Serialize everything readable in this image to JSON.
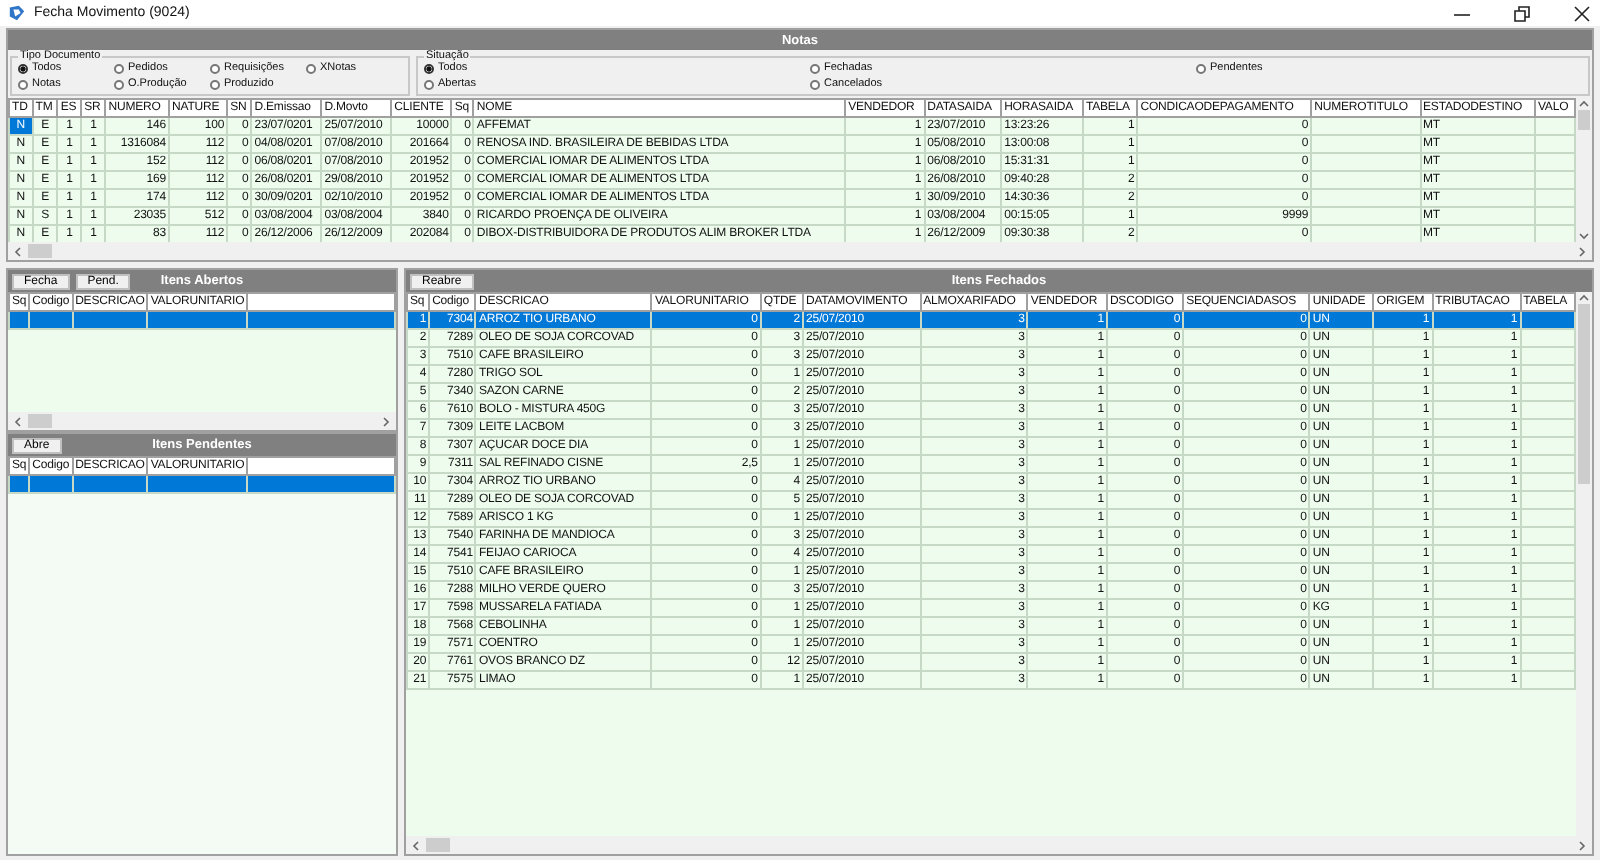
{
  "window": {
    "title": "Fecha Movimento (9024)"
  },
  "notas": {
    "title": "Notas",
    "tipo_documento": {
      "legend": "Tipo Documento",
      "options": [
        {
          "label": "Todos",
          "selected": true
        },
        {
          "label": "Pedidos",
          "selected": false
        },
        {
          "label": "Requisições",
          "selected": false
        },
        {
          "label": "XNotas",
          "selected": false
        },
        {
          "label": "Notas",
          "selected": false
        },
        {
          "label": "O.Produção",
          "selected": false
        },
        {
          "label": "Produzido",
          "selected": false
        }
      ]
    },
    "situacao": {
      "legend": "Situação",
      "options": [
        {
          "label": "Todos",
          "selected": true
        },
        {
          "label": "Fechadas",
          "selected": false
        },
        {
          "label": "Pendentes",
          "selected": false
        },
        {
          "label": "Abertas",
          "selected": false
        },
        {
          "label": "Cancelados",
          "selected": false
        }
      ]
    },
    "table": {
      "columns": [
        "TD",
        "TM",
        "ES",
        "SR",
        "NUMERO",
        "NATURE",
        "SN",
        "D.Emissao",
        "D.Movto",
        "CLIENTE",
        "Sq",
        "NOME",
        "VENDEDOR",
        "DATASAIDA",
        "HORASAIDA",
        "TABELA",
        "CONDICAODEPAGAMENTO",
        "NUMEROTITULO",
        "ESTADODESTINO",
        "VALO"
      ],
      "rows": [
        {
          "selected": true,
          "cells": [
            "N",
            "E",
            "1",
            "1",
            "146",
            "100",
            "0",
            "23/07/0201",
            "25/07/2010",
            "10000",
            "0",
            "AFFEMAT",
            "1",
            "23/07/2010",
            "13:23:26",
            "1",
            "0",
            null,
            "MT"
          ]
        },
        {
          "selected": false,
          "cells": [
            "N",
            "E",
            "1",
            "1",
            "1316084",
            "112",
            "0",
            "04/08/0201",
            "07/08/2010",
            "201664",
            "0",
            "RENOSA IND. BRASILEIRA DE BEBIDAS LTDA",
            "1",
            "05/08/2010",
            "13:00:08",
            "1",
            "0",
            null,
            "MT"
          ]
        },
        {
          "selected": false,
          "cells": [
            "N",
            "E",
            "1",
            "1",
            "152",
            "112",
            "0",
            "06/08/0201",
            "07/08/2010",
            "201952",
            "0",
            "COMERCIAL IOMAR DE ALIMENTOS LTDA",
            "1",
            "06/08/2010",
            "15:31:31",
            "1",
            "0",
            null,
            "MT"
          ]
        },
        {
          "selected": false,
          "cells": [
            "N",
            "E",
            "1",
            "1",
            "169",
            "112",
            "0",
            "26/08/0201",
            "29/08/2010",
            "201952",
            "0",
            "COMERCIAL IOMAR DE ALIMENTOS LTDA",
            "1",
            "26/08/2010",
            "09:40:28",
            "2",
            "0",
            null,
            "MT"
          ]
        },
        {
          "selected": false,
          "cells": [
            "N",
            "E",
            "1",
            "1",
            "174",
            "112",
            "0",
            "30/09/0201",
            "02/10/2010",
            "201952",
            "0",
            "COMERCIAL IOMAR DE ALIMENTOS LTDA",
            "1",
            "30/09/2010",
            "14:30:36",
            "2",
            "0",
            null,
            "MT"
          ]
        },
        {
          "selected": false,
          "cells": [
            "N",
            "S",
            "1",
            "1",
            "23035",
            "512",
            "0",
            "03/08/2004",
            "03/08/2004",
            "3840",
            "0",
            "RICARDO PROENÇA DE OLIVEIRA",
            "1",
            "03/08/2004",
            "00:15:05",
            "1",
            "9999",
            null,
            "MT"
          ]
        },
        {
          "selected": false,
          "cells": [
            "N",
            "E",
            "1",
            "1",
            "83",
            "112",
            "0",
            "26/12/2006",
            "26/12/2009",
            "202084",
            "0",
            "DIBOX-DISTRIBUIDORA DE PRODUTOS ALIM BROKER LTDA",
            "1",
            "26/12/2009",
            "09:30:38",
            "2",
            "0",
            null,
            "MT"
          ]
        }
      ]
    }
  },
  "itens_abertos": {
    "title": "Itens Abertos",
    "buttons": [
      "Fecha",
      "Pend."
    ],
    "columns": [
      "Sq",
      "Codigo",
      "DESCRICAO",
      "VALORUNITARIO"
    ],
    "rows": [
      {
        "selected": true
      }
    ]
  },
  "itens_pendentes": {
    "title": "Itens Pendentes",
    "buttons": [
      "Abre"
    ],
    "columns": [
      "Sq",
      "Codigo",
      "DESCRICAO",
      "VALORUNITARIO"
    ],
    "rows": [
      {
        "selected": true
      }
    ]
  },
  "itens_fechados": {
    "title": "Itens Fechados",
    "buttons": [
      "Reabre"
    ],
    "columns": [
      "Sq",
      "Codigo",
      "DESCRICAO",
      "VALORUNITARIO",
      "QTDE",
      "DATAMOVIMENTO",
      "ALMOXARIFADO",
      "VENDEDOR",
      "DSCODIGO",
      "SEQUENCIADASOS",
      "UNIDADE",
      "ORIGEM",
      "TRIBUTACAO",
      "TABELA"
    ],
    "rows": [
      {
        "selected": true,
        "cells": [
          "1",
          "7304",
          "ARROZ TIO URBANO",
          "0",
          "2",
          "25/07/2010",
          "3",
          "1",
          "0",
          "0",
          "UN",
          "1",
          "1"
        ]
      },
      {
        "selected": false,
        "cells": [
          "2",
          "7289",
          "OLEO DE SOJA CORCOVAD",
          "0",
          "3",
          "25/07/2010",
          "3",
          "1",
          "0",
          "0",
          "UN",
          "1",
          "1"
        ]
      },
      {
        "selected": false,
        "cells": [
          "3",
          "7510",
          "CAFE BRASILEIRO",
          "0",
          "3",
          "25/07/2010",
          "3",
          "1",
          "0",
          "0",
          "UN",
          "1",
          "1"
        ]
      },
      {
        "selected": false,
        "cells": [
          "4",
          "7280",
          "TRIGO SOL",
          "0",
          "1",
          "25/07/2010",
          "3",
          "1",
          "0",
          "0",
          "UN",
          "1",
          "1"
        ]
      },
      {
        "selected": false,
        "cells": [
          "5",
          "7340",
          "SAZON CARNE",
          "0",
          "2",
          "25/07/2010",
          "3",
          "1",
          "0",
          "0",
          "UN",
          "1",
          "1"
        ]
      },
      {
        "selected": false,
        "cells": [
          "6",
          "7610",
          "BOLO - MISTURA  450G",
          "0",
          "3",
          "25/07/2010",
          "3",
          "1",
          "0",
          "0",
          "UN",
          "1",
          "1"
        ]
      },
      {
        "selected": false,
        "cells": [
          "7",
          "7309",
          "LEITE LACBOM",
          "0",
          "3",
          "25/07/2010",
          "3",
          "1",
          "0",
          "0",
          "UN",
          "1",
          "1"
        ]
      },
      {
        "selected": false,
        "cells": [
          "8",
          "7307",
          "AÇUCAR DOCE DIA",
          "0",
          "1",
          "25/07/2010",
          "3",
          "1",
          "0",
          "0",
          "UN",
          "1",
          "1"
        ]
      },
      {
        "selected": false,
        "cells": [
          "9",
          "7311",
          "SAL REFINADO CISNE",
          "2,5",
          "1",
          "25/07/2010",
          "3",
          "1",
          "0",
          "0",
          "UN",
          "1",
          "1"
        ]
      },
      {
        "selected": false,
        "cells": [
          "10",
          "7304",
          "ARROZ TIO URBANO",
          "0",
          "4",
          "25/07/2010",
          "3",
          "1",
          "0",
          "0",
          "UN",
          "1",
          "1"
        ]
      },
      {
        "selected": false,
        "cells": [
          "11",
          "7289",
          "OLEO DE SOJA CORCOVAD",
          "0",
          "5",
          "25/07/2010",
          "3",
          "1",
          "0",
          "0",
          "UN",
          "1",
          "1"
        ]
      },
      {
        "selected": false,
        "cells": [
          "12",
          "7589",
          "ARISCO 1 KG",
          "0",
          "1",
          "25/07/2010",
          "3",
          "1",
          "0",
          "0",
          "UN",
          "1",
          "1"
        ]
      },
      {
        "selected": false,
        "cells": [
          "13",
          "7540",
          "FARINHA DE MANDIOCA",
          "0",
          "3",
          "25/07/2010",
          "3",
          "1",
          "0",
          "0",
          "UN",
          "1",
          "1"
        ]
      },
      {
        "selected": false,
        "cells": [
          "14",
          "7541",
          "FEIJAO CARIOCA",
          "0",
          "4",
          "25/07/2010",
          "3",
          "1",
          "0",
          "0",
          "UN",
          "1",
          "1"
        ]
      },
      {
        "selected": false,
        "cells": [
          "15",
          "7510",
          "CAFE BRASILEIRO",
          "0",
          "1",
          "25/07/2010",
          "3",
          "1",
          "0",
          "0",
          "UN",
          "1",
          "1"
        ]
      },
      {
        "selected": false,
        "cells": [
          "16",
          "7288",
          "MILHO VERDE QUERO",
          "0",
          "3",
          "25/07/2010",
          "3",
          "1",
          "0",
          "0",
          "UN",
          "1",
          "1"
        ]
      },
      {
        "selected": false,
        "cells": [
          "17",
          "7598",
          "MUSSARELA FATIADA",
          "0",
          "1",
          "25/07/2010",
          "3",
          "1",
          "0",
          "0",
          "KG",
          "1",
          "1"
        ]
      },
      {
        "selected": false,
        "cells": [
          "18",
          "7568",
          "CEBOLINHA",
          "0",
          "1",
          "25/07/2010",
          "3",
          "1",
          "0",
          "0",
          "UN",
          "1",
          "1"
        ]
      },
      {
        "selected": false,
        "cells": [
          "19",
          "7571",
          "COENTRO",
          "0",
          "1",
          "25/07/2010",
          "3",
          "1",
          "0",
          "0",
          "UN",
          "1",
          "1"
        ]
      },
      {
        "selected": false,
        "cells": [
          "20",
          "7761",
          "OVOS BRANCO DZ",
          "0",
          "12",
          "25/07/2010",
          "3",
          "1",
          "0",
          "0",
          "UN",
          "1",
          "1"
        ]
      },
      {
        "selected": false,
        "cells": [
          "21",
          "7575",
          "LIMAO",
          "0",
          "1",
          "25/07/2010",
          "3",
          "1",
          "0",
          "0",
          "UN",
          "1",
          "1"
        ]
      }
    ]
  }
}
